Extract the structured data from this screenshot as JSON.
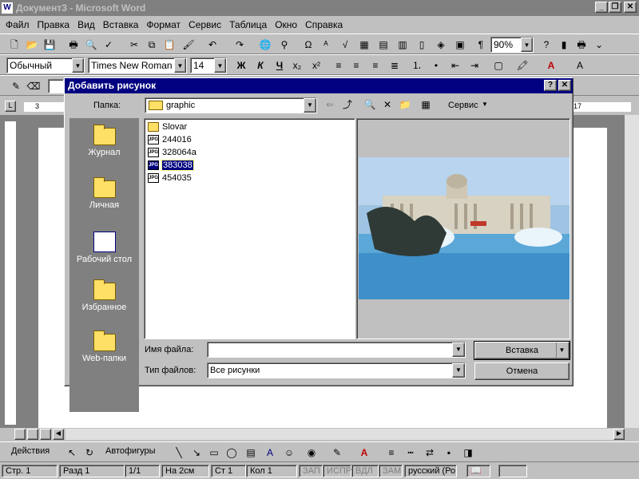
{
  "window": {
    "title": "Документ3 - Microsoft Word"
  },
  "menu": [
    "Файл",
    "Правка",
    "Вид",
    "Вставка",
    "Формат",
    "Сервис",
    "Таблица",
    "Окно",
    "Справка"
  ],
  "format": {
    "style": "Обычный",
    "font": "Times New Roman",
    "size": "14",
    "bold": "Ж",
    "italic": "К",
    "underline": "Ч"
  },
  "zoom": "90%",
  "ruler": {
    "left_mark": "3",
    "right_mark": "17"
  },
  "dialog": {
    "title": "Добавить рисунок",
    "folder_label": "Папка:",
    "folder_value": "graphic",
    "tools_label": "Сервис",
    "places": [
      "Журнал",
      "Личная",
      "Рабочий стол",
      "Избранное",
      "Web-папки"
    ],
    "files": [
      {
        "name": "Slovar",
        "type": "folder"
      },
      {
        "name": "244016",
        "type": "jpg"
      },
      {
        "name": "328064a",
        "type": "jpg"
      },
      {
        "name": "383038",
        "type": "jpg"
      },
      {
        "name": "454035",
        "type": "jpg"
      }
    ],
    "selected_file": "383038",
    "filename_label": "Имя файла:",
    "filename_value": "",
    "filetype_label": "Тип файлов:",
    "filetype_value": "Все рисунки",
    "insert_label": "Вставка",
    "cancel_label": "Отмена"
  },
  "drawing": {
    "actions": "Действия",
    "autoshapes": "Автофигуры"
  },
  "status": {
    "page": "Стр. 1",
    "section": "Разд 1",
    "pages": "1/1",
    "at": "На 2см",
    "line": "Ст 1",
    "col": "Кол 1",
    "rec": "ЗАП",
    "trk": "ИСПР",
    "ext": "ВДЛ",
    "ovr": "ЗАМ",
    "lang": "русский (Ро"
  }
}
